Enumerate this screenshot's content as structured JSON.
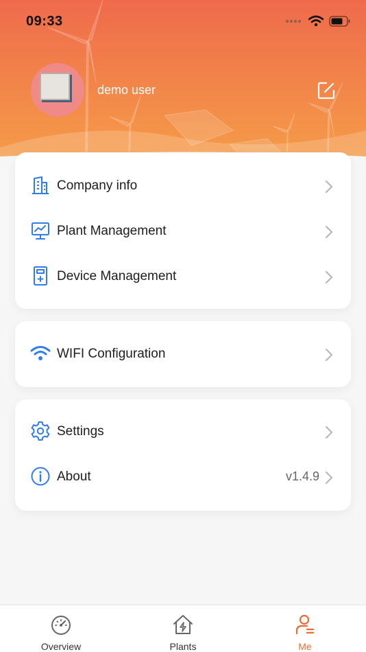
{
  "status_bar": {
    "time": "09:33"
  },
  "profile": {
    "username": "demo user"
  },
  "menu_groups": [
    {
      "items": [
        {
          "label": "Company info",
          "icon": "building-icon"
        },
        {
          "label": "Plant Management",
          "icon": "monitor-chart-icon"
        },
        {
          "label": "Device Management",
          "icon": "device-icon"
        }
      ]
    },
    {
      "items": [
        {
          "label": "WIFI Configuration",
          "icon": "wifi-icon"
        }
      ]
    },
    {
      "items": [
        {
          "label": "Settings",
          "icon": "gear-icon"
        },
        {
          "label": "About",
          "icon": "info-icon",
          "value": "v1.4.9"
        }
      ]
    }
  ],
  "tabs": [
    {
      "label": "Overview",
      "icon": "gauge-icon",
      "active": false
    },
    {
      "label": "Plants",
      "icon": "house-bolt-icon",
      "active": false
    },
    {
      "label": "Me",
      "icon": "user-icon",
      "active": true
    }
  ],
  "colors": {
    "accent": "#ee6a32",
    "icon_blue": "#2f7cf0",
    "header_top": "#ef6a4c",
    "header_bottom": "#f5a048"
  }
}
